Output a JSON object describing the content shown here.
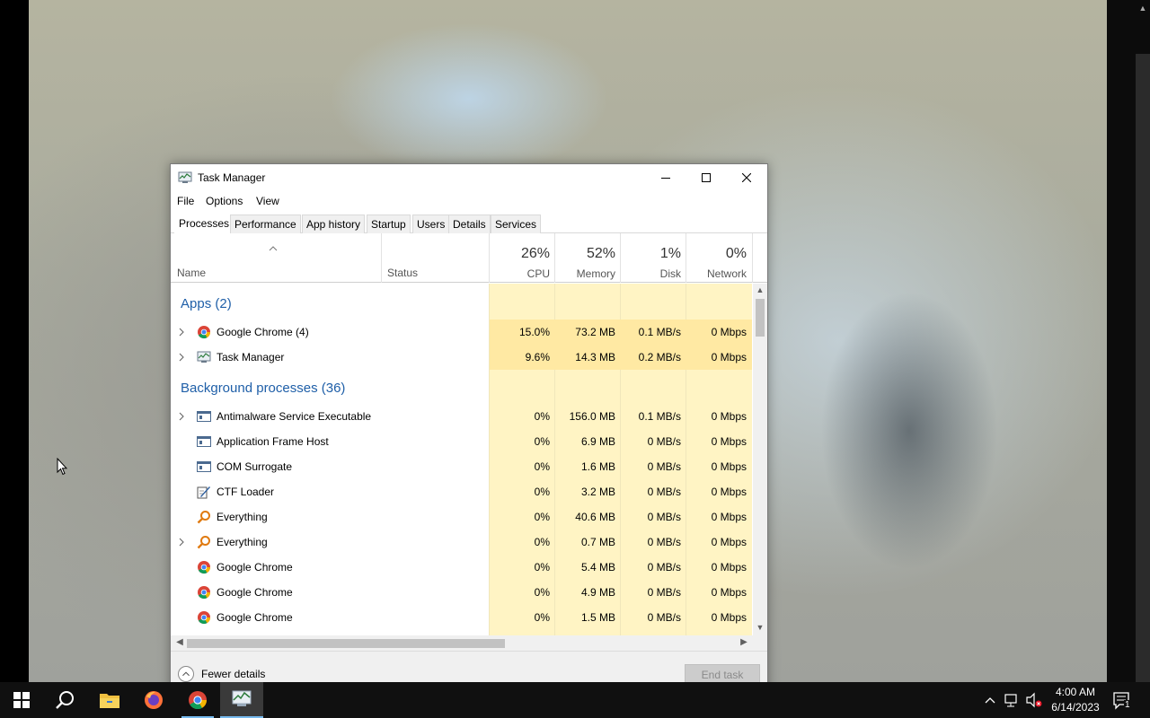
{
  "window": {
    "title": "Task Manager",
    "menu": [
      "File",
      "Options",
      "View"
    ],
    "tabs": [
      "Processes",
      "Performance",
      "App history",
      "Startup",
      "Users",
      "Details",
      "Services"
    ],
    "active_tab": "Processes"
  },
  "columns": {
    "name": "Name",
    "status": "Status",
    "cpu": {
      "pct": "26%",
      "label": "CPU"
    },
    "memory": {
      "pct": "52%",
      "label": "Memory"
    },
    "disk": {
      "pct": "1%",
      "label": "Disk"
    },
    "network": {
      "pct": "0%",
      "label": "Network"
    }
  },
  "groups": {
    "apps": "Apps (2)",
    "background": "Background processes (36)"
  },
  "apps": [
    {
      "name": "Google Chrome (4)",
      "icon": "chrome-icon",
      "expandable": true,
      "cpu": "15.0%",
      "memory": "73.2 MB",
      "disk": "0.1 MB/s",
      "network": "0 Mbps"
    },
    {
      "name": "Task Manager",
      "icon": "task-manager-icon",
      "expandable": true,
      "cpu": "9.6%",
      "memory": "14.3 MB",
      "disk": "0.2 MB/s",
      "network": "0 Mbps"
    }
  ],
  "background": [
    {
      "name": "Antimalware Service Executable",
      "icon": "service-window-icon",
      "expandable": true,
      "cpu": "0%",
      "memory": "156.0 MB",
      "disk": "0.1 MB/s",
      "network": "0 Mbps"
    },
    {
      "name": "Application Frame Host",
      "icon": "service-window-icon",
      "expandable": false,
      "cpu": "0%",
      "memory": "6.9 MB",
      "disk": "0 MB/s",
      "network": "0 Mbps"
    },
    {
      "name": "COM Surrogate",
      "icon": "service-window-icon",
      "expandable": false,
      "cpu": "0%",
      "memory": "1.6 MB",
      "disk": "0 MB/s",
      "network": "0 Mbps"
    },
    {
      "name": "CTF Loader",
      "icon": "ctf-loader-icon",
      "expandable": false,
      "cpu": "0%",
      "memory": "3.2 MB",
      "disk": "0 MB/s",
      "network": "0 Mbps"
    },
    {
      "name": "Everything",
      "icon": "everything-search-icon",
      "expandable": false,
      "cpu": "0%",
      "memory": "40.6 MB",
      "disk": "0 MB/s",
      "network": "0 Mbps"
    },
    {
      "name": "Everything",
      "icon": "everything-search-icon",
      "expandable": true,
      "cpu": "0%",
      "memory": "0.7 MB",
      "disk": "0 MB/s",
      "network": "0 Mbps"
    },
    {
      "name": "Google Chrome",
      "icon": "chrome-icon",
      "expandable": false,
      "cpu": "0%",
      "memory": "5.4 MB",
      "disk": "0 MB/s",
      "network": "0 Mbps"
    },
    {
      "name": "Google Chrome",
      "icon": "chrome-icon",
      "expandable": false,
      "cpu": "0%",
      "memory": "4.9 MB",
      "disk": "0 MB/s",
      "network": "0 Mbps"
    },
    {
      "name": "Google Chrome",
      "icon": "chrome-icon",
      "expandable": false,
      "cpu": "0%",
      "memory": "1.5 MB",
      "disk": "0 MB/s",
      "network": "0 Mbps"
    }
  ],
  "footer": {
    "fewer_details": "Fewer details",
    "end_task": "End task"
  },
  "taskbar": {
    "apps": [
      "start-icon",
      "search-icon",
      "file-explorer-icon",
      "firefox-icon",
      "chrome-icon",
      "task-manager-icon"
    ],
    "time": "4:00 AM",
    "date": "6/14/2023",
    "notification_count": "1"
  },
  "colors": {
    "group_heading": "#1f5fa8",
    "heat_low": "#fff4c4",
    "heat_mid": "#ffe9a3",
    "taskbar": "#101010",
    "accent": "#76b9ed"
  }
}
